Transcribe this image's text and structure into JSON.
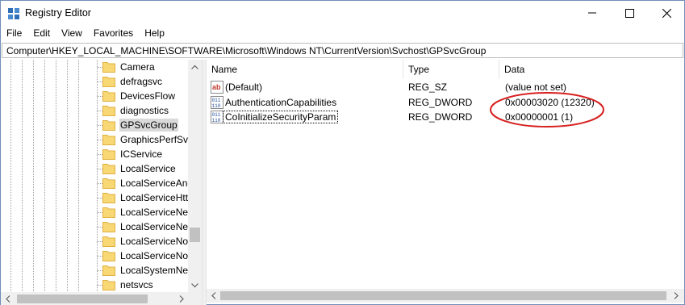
{
  "window": {
    "title": "Registry Editor"
  },
  "menu": [
    "File",
    "Edit",
    "View",
    "Favorites",
    "Help"
  ],
  "address": "Computer\\HKEY_LOCAL_MACHINE\\SOFTWARE\\Microsoft\\Windows NT\\CurrentVersion\\Svchost\\GPSvcGroup",
  "tree": {
    "items": [
      {
        "label": "Camera",
        "selected": false
      },
      {
        "label": "defragsvc",
        "selected": false
      },
      {
        "label": "DevicesFlow",
        "selected": false
      },
      {
        "label": "diagnostics",
        "selected": false
      },
      {
        "label": "GPSvcGroup",
        "selected": true
      },
      {
        "label": "GraphicsPerfSvc",
        "selected": false
      },
      {
        "label": "ICService",
        "selected": false
      },
      {
        "label": "LocalService",
        "selected": false
      },
      {
        "label": "LocalServiceAnd",
        "selected": false
      },
      {
        "label": "LocalServiceHtt",
        "selected": false
      },
      {
        "label": "LocalServiceNet",
        "selected": false
      },
      {
        "label": "LocalServiceNet",
        "selected": false
      },
      {
        "label": "LocalServiceNol",
        "selected": false
      },
      {
        "label": "LocalServiceNol",
        "selected": false
      },
      {
        "label": "LocalSystemNet",
        "selected": false
      },
      {
        "label": "netsvcs",
        "selected": false
      }
    ]
  },
  "list": {
    "columns": [
      "Name",
      "Type",
      "Data"
    ],
    "rows": [
      {
        "name": "(Default)",
        "type": "REG_SZ",
        "data": "(value not set)",
        "icon": "string-value-icon"
      },
      {
        "name": "AuthenticationCapabilities",
        "type": "REG_DWORD",
        "data": "0x00003020 (12320)",
        "icon": "dword-value-icon"
      },
      {
        "name": "CoInitializeSecurityParam",
        "type": "REG_DWORD",
        "data": "0x00000001 (1)",
        "icon": "dword-value-icon"
      }
    ]
  },
  "colors": {
    "folder": "#f8d775",
    "folder_edge": "#e0b040",
    "selected_bg": "#d9d9d9",
    "annotation": "#d81f1f"
  }
}
